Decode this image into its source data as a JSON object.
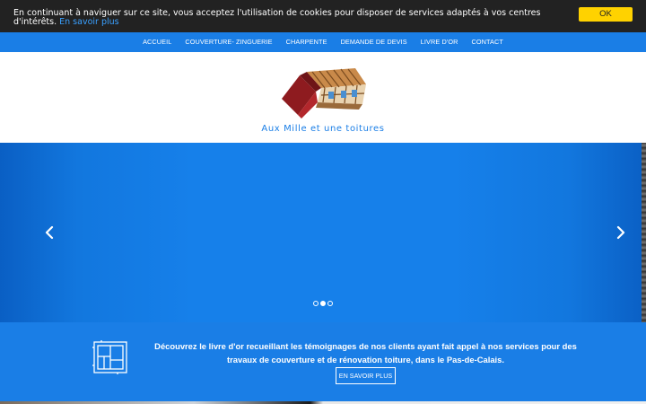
{
  "cookie": {
    "text": "En continuant à naviguer sur ce site, vous acceptez l'utilisation de cookies pour disposer de services adaptés à vos centres d'intérêts.",
    "link_label": "En savoir plus",
    "ok_label": "OK"
  },
  "nav": {
    "items": [
      {
        "label": "ACCUEIL"
      },
      {
        "label": "COUVERTURE- ZINGUERIE"
      },
      {
        "label": "CHARPENTE"
      },
      {
        "label": "DEMANDE DE DEVIS"
      },
      {
        "label": "LIVRE D'OR"
      },
      {
        "label": "CONTACT"
      }
    ]
  },
  "header": {
    "site_title": "Aux Mille et une toitures",
    "logo_icon": "house-roof-logo"
  },
  "carousel": {
    "prev_icon": "chevron-left-icon",
    "next_icon": "chevron-right-icon",
    "slide_count": 3,
    "active_slide": 2
  },
  "info": {
    "icon": "blueprint-icon",
    "text": "Découvrez le livre d'or recueillant les témoignages de nos clients ayant fait appel à nos services pour des travaux de couverture et de rénovation toiture, dans le Pas-de-Calais.",
    "button_label": "EN SAVOIR PLUS"
  },
  "colors": {
    "primary": "#1a7ee6",
    "cookie_bg": "#222222",
    "ok_button": "#ffd200",
    "link": "#3aa0ff"
  }
}
